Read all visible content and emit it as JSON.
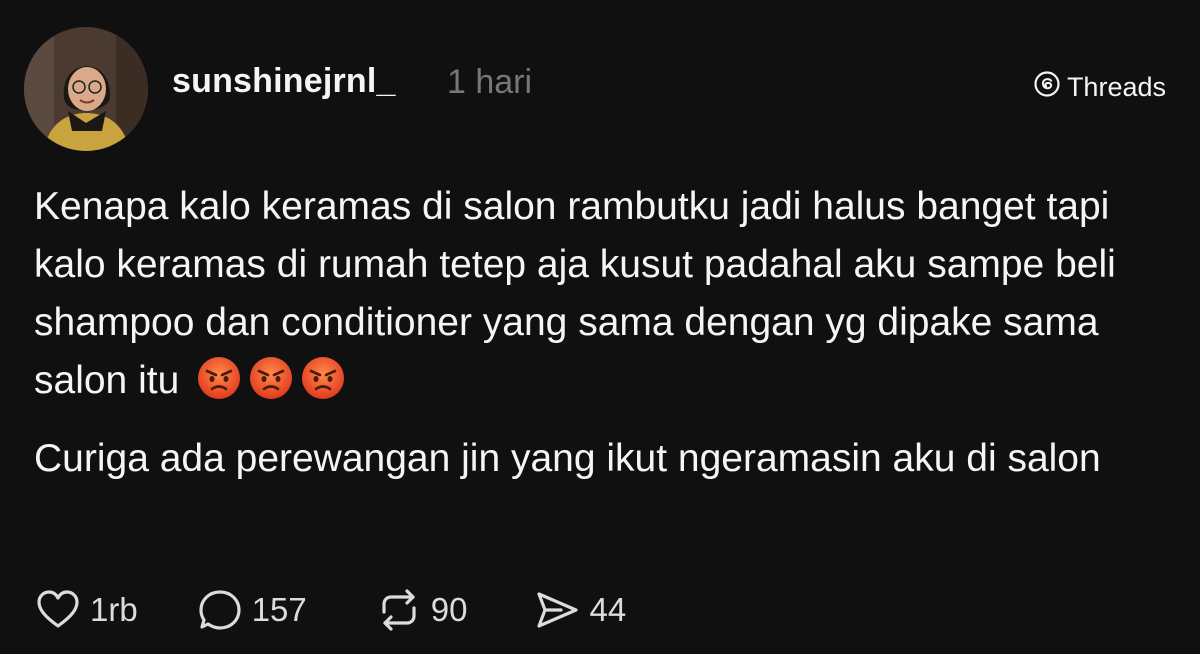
{
  "post": {
    "username": "sunshinejrnl_",
    "timestamp": "1 hari",
    "brand": "Threads",
    "brand_icon": "threads-logo-icon",
    "paragraph1": "Kenapa kalo keramas di salon rambutku jadi halus banget tapi kalo keramas di rumah tetep aja kusut padahal aku sampe beli shampoo dan conditioner yang sama dengan yg dipake sama salon itu",
    "emoji_icon": "angry-face-emoji",
    "emoji_count": 3,
    "paragraph2": "Curiga ada perewangan jin yang ikut ngeramasin aku di salon"
  },
  "actions": {
    "like_count": "1rb",
    "reply_count": "157",
    "repost_count": "90",
    "share_count": "44"
  },
  "colors": {
    "background": "#101010",
    "text": "#f3f5f7",
    "muted": "#777777",
    "emoji": "#e8512a"
  }
}
